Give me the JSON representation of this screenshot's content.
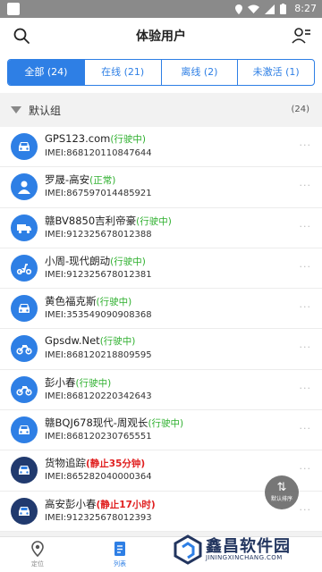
{
  "status_bar": {
    "time": "8:27"
  },
  "header": {
    "title": "体验用户"
  },
  "tabs": [
    {
      "label": "全部 (24)",
      "active": true
    },
    {
      "label": "在线 (21)",
      "active": false
    },
    {
      "label": "离线 (2)",
      "active": false
    },
    {
      "label": "未激活 (1)",
      "active": false
    }
  ],
  "group": {
    "name": "默认组",
    "count": "(24)"
  },
  "devices": [
    {
      "name": "GPS123.com",
      "status": "(行驶中)",
      "status_color": "green",
      "imei": "IMEI:868120110847644",
      "icon": "car-icon"
    },
    {
      "name": "罗晟-高安",
      "status": "(正常)",
      "status_color": "green",
      "imei": "IMEI:867597014485921",
      "icon": "person-icon"
    },
    {
      "name": "赣BV8850吉利帝豪",
      "status": "(行驶中)",
      "status_color": "green",
      "imei": "IMEI:912325678012388",
      "icon": "truck-icon"
    },
    {
      "name": "小周-现代朗动",
      "status": "(行驶中)",
      "status_color": "green",
      "imei": "IMEI:912325678012381",
      "icon": "scooter-icon"
    },
    {
      "name": "黄色福克斯",
      "status": "(行驶中)",
      "status_color": "green",
      "imei": "IMEI:353549090908368",
      "icon": "car-icon"
    },
    {
      "name": "Gpsdw.Net",
      "status": "(行驶中)",
      "status_color": "green",
      "imei": "IMEI:868120218809595",
      "icon": "motorcycle-icon"
    },
    {
      "name": "彭小春",
      "status": "(行驶中)",
      "status_color": "green",
      "imei": "IMEI:868120220342643",
      "icon": "motorcycle-icon"
    },
    {
      "name": "赣BQJ678现代-周观长",
      "status": "(行驶中)",
      "status_color": "green",
      "imei": "IMEI:868120230765551",
      "icon": "car-icon"
    },
    {
      "name": "货物追踪",
      "status": "(静止35分钟)",
      "status_color": "red",
      "imei": "IMEI:865282040000364",
      "icon": "car-icon",
      "dark": true
    },
    {
      "name": "高安彭小春",
      "status": "(静止17小时)",
      "status_color": "red",
      "imei": "IMEI:912325678012393",
      "icon": "car-icon",
      "dark": true
    }
  ],
  "more_label": "···",
  "fab": {
    "label": "默认排序"
  },
  "bottom_nav": [
    {
      "label": "定位",
      "active": false
    },
    {
      "label": "列表",
      "active": true
    }
  ],
  "watermark": {
    "title": "鑫昌软件园",
    "subtitle": "JININGXINCHANG.COM"
  },
  "colors": {
    "accent": "#2e7fe5",
    "running": "#2fb02f",
    "stopped": "#e02020",
    "dark_avatar": "#213a6e"
  }
}
